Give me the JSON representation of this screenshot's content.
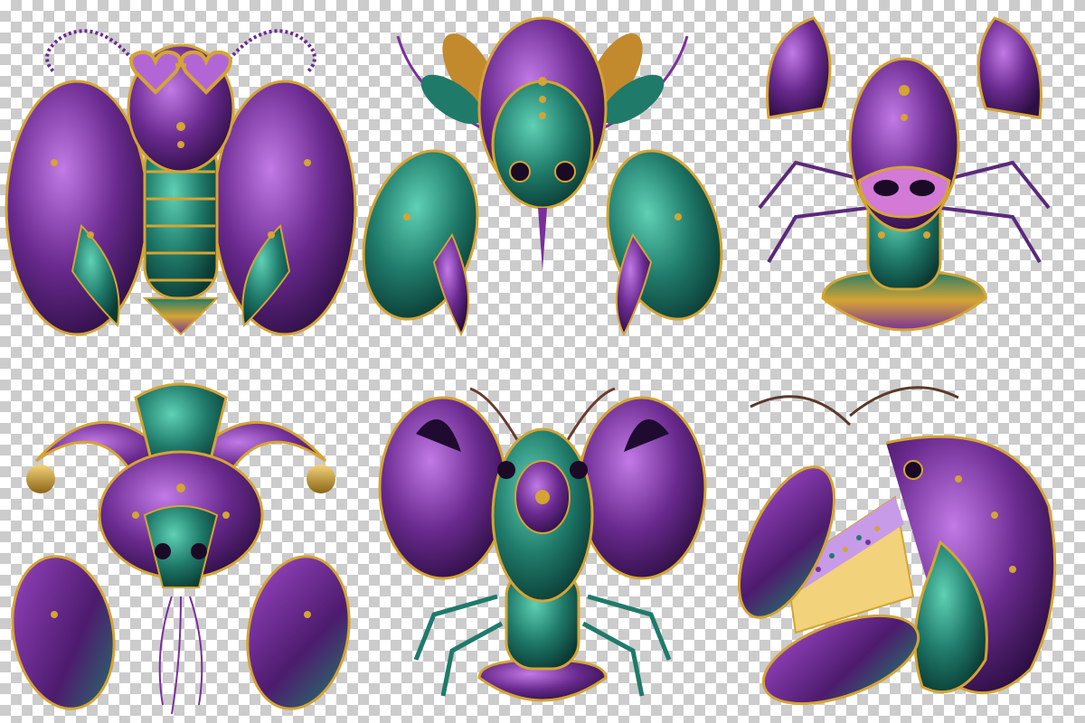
{
  "palette": {
    "purple": "#6a2a8f",
    "purple_light": "#b266d6",
    "teal": "#1f7a6a",
    "teal_light": "#3fb39a",
    "gold": "#d4a434",
    "gold_dark": "#8a6416",
    "pink": "#d27ad6",
    "cake_sponge": "#f2d27a",
    "cake_frosting": "#c79be8"
  },
  "background": "transparency-checkerboard",
  "illustrations": [
    {
      "id": "crawfish-sunglasses",
      "accessory": "heart-sunglasses-icon"
    },
    {
      "id": "crawfish-feathered",
      "accessory": "feather-plume-icon"
    },
    {
      "id": "crawfish-masquerade",
      "accessory": "masquerade-mask-icon"
    },
    {
      "id": "crawfish-jester",
      "accessory": "jester-hat-icon"
    },
    {
      "id": "crawfish-ornate",
      "accessory": "ornate-jewel-icon"
    },
    {
      "id": "crawfish-king-cake",
      "accessory": "king-cake-slice-icon"
    }
  ]
}
